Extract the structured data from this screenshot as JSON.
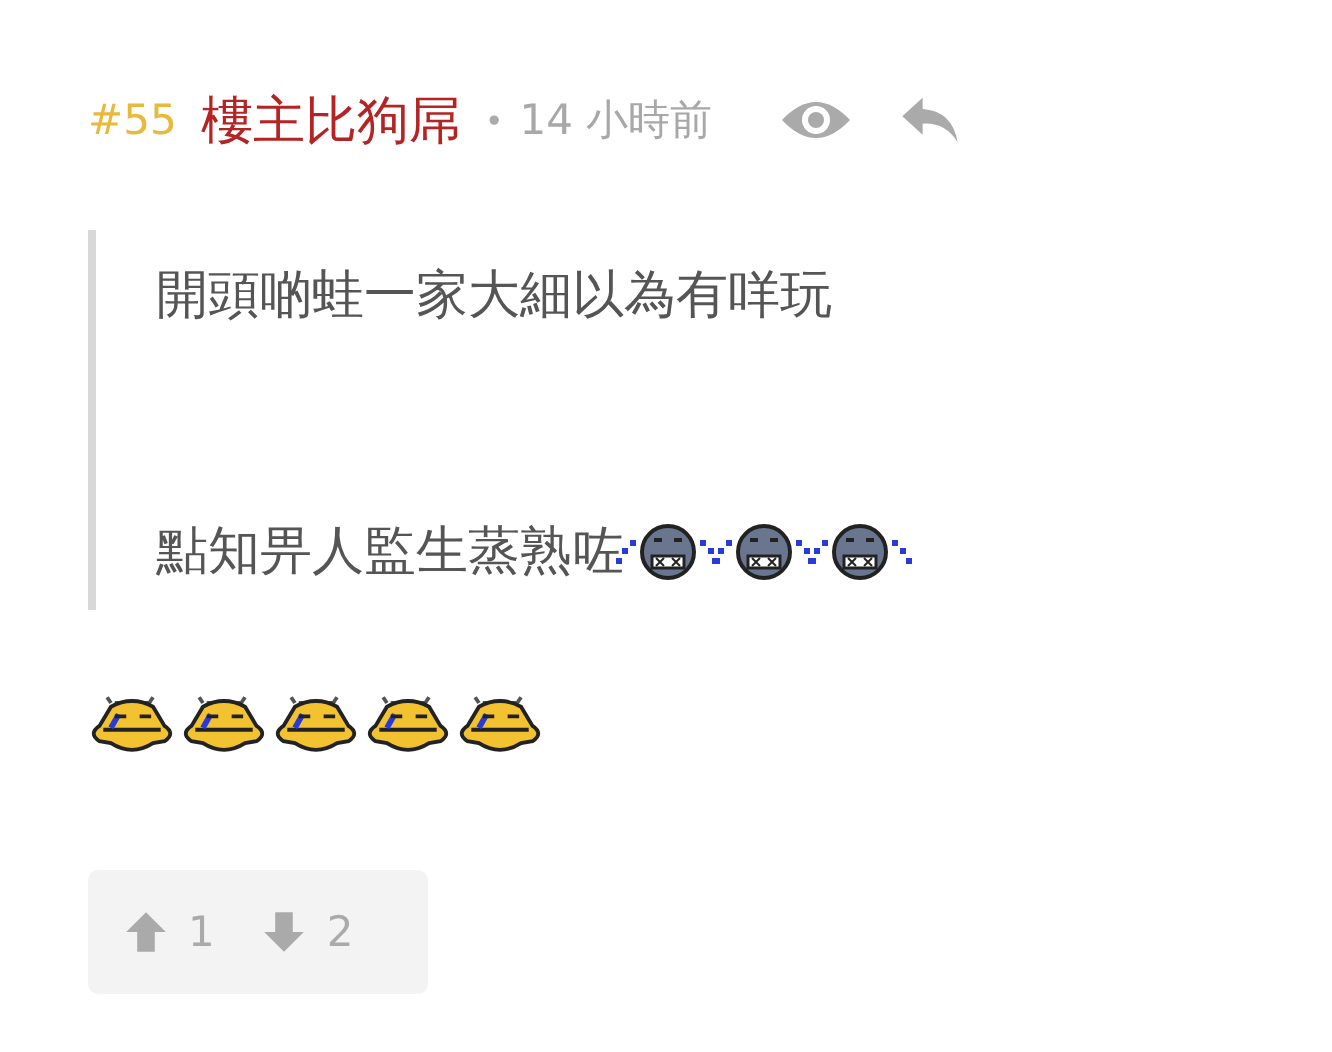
{
  "post": {
    "number": "#55",
    "author": "樓主比狗屌",
    "separator": "•",
    "time": "14 小時前"
  },
  "quote": {
    "lines": [
      {
        "text": "開頭啲蛙一家大細以為有咩玩"
      },
      {
        "text": "點知畀人監生蒸熟咗",
        "emojis": [
          {
            "kind": "crying"
          },
          {
            "kind": "crying"
          },
          {
            "kind": "crying"
          }
        ]
      }
    ]
  },
  "emojis": [
    {
      "kind": "yellow"
    },
    {
      "kind": "yellow"
    },
    {
      "kind": "yellow"
    },
    {
      "kind": "yellow"
    },
    {
      "kind": "yellow"
    }
  ],
  "votes": {
    "up": "1",
    "down": "2"
  }
}
